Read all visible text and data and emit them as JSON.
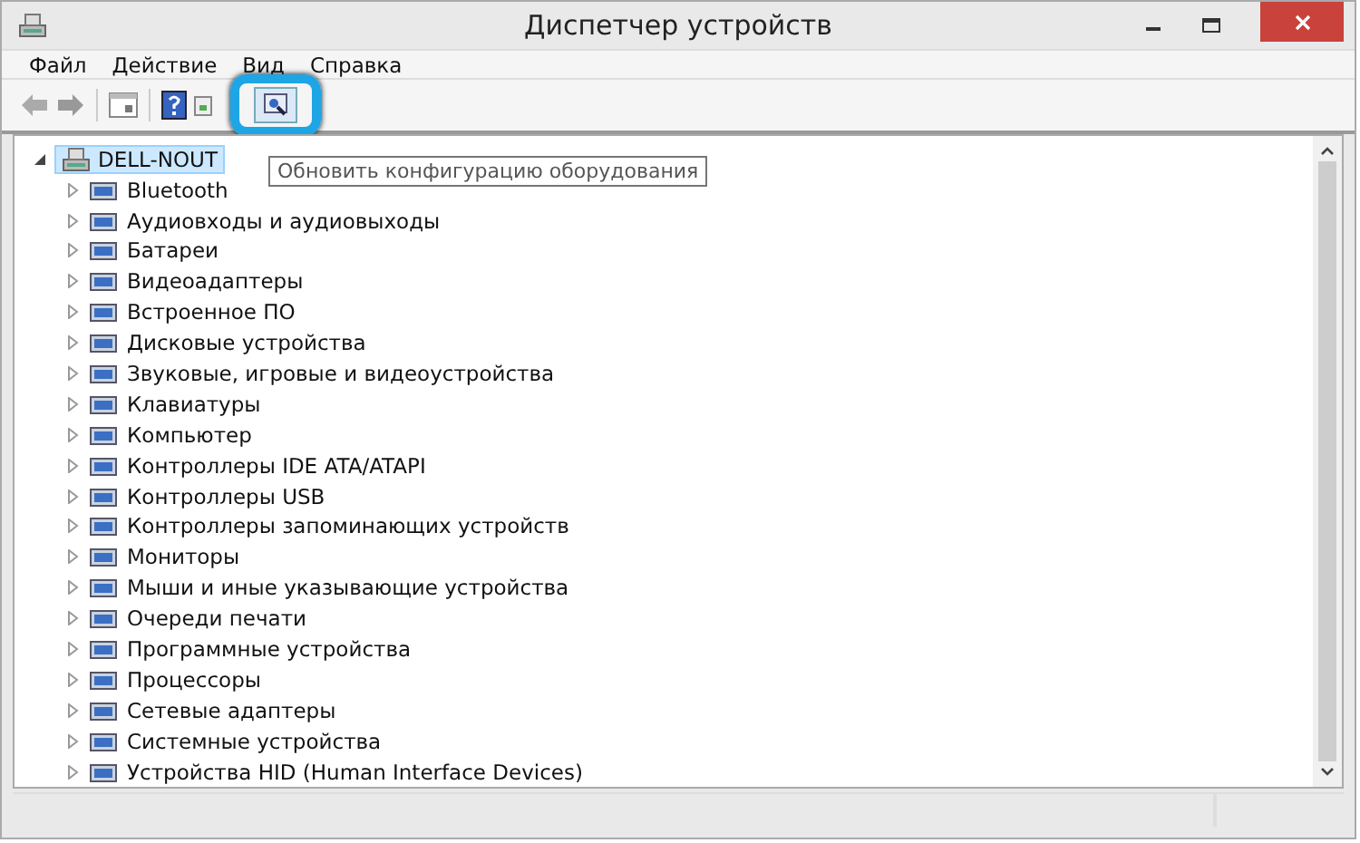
{
  "window": {
    "title": "Диспетчер устройств"
  },
  "menu": [
    "Файл",
    "Действие",
    "Вид",
    "Справка"
  ],
  "toolbar": {
    "tooltip": "Обновить конфигурацию оборудования"
  },
  "tree": {
    "label": "DELL-NOUT",
    "selected": true,
    "expanded": true,
    "children": [
      {
        "label": "Bluetooth",
        "expanded": false
      },
      {
        "label": "Аудиовходы и аудиовыходы",
        "expanded": false
      },
      {
        "label": "Батареи",
        "expanded": false
      },
      {
        "label": "Видеоадаптеры",
        "expanded": false
      },
      {
        "label": "Встроенное ПО",
        "expanded": false
      },
      {
        "label": "Дисковые устройства",
        "expanded": false
      },
      {
        "label": "Звуковые, игровые и видеоустройства",
        "expanded": false
      },
      {
        "label": "Клавиатуры",
        "expanded": false
      },
      {
        "label": "Компьютер",
        "expanded": false
      },
      {
        "label": "Контроллеры IDE ATA/ATAPI",
        "expanded": false
      },
      {
        "label": "Контроллеры USB",
        "expanded": false
      },
      {
        "label": "Контроллеры запоминающих устройств",
        "expanded": false
      },
      {
        "label": "Мониторы",
        "expanded": false
      },
      {
        "label": "Мыши и иные указывающие устройства",
        "expanded": false
      },
      {
        "label": "Очереди печати",
        "expanded": false
      },
      {
        "label": "Программные устройства",
        "expanded": false
      },
      {
        "label": "Процессоры",
        "expanded": false
      },
      {
        "label": "Сетевые адаптеры",
        "expanded": false
      },
      {
        "label": "Системные устройства",
        "expanded": false
      },
      {
        "label": "Устройства HID (Human Interface Devices)",
        "expanded": false
      }
    ]
  }
}
